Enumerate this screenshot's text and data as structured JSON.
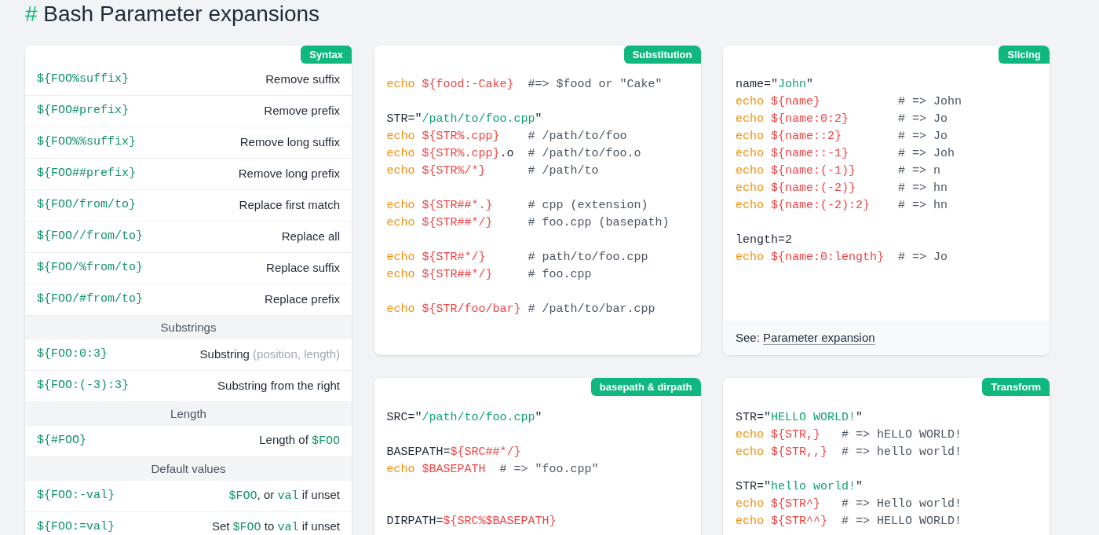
{
  "title": {
    "hash": "#",
    "text": "Bash Parameter expansions"
  },
  "syntax_card": {
    "badge": "Syntax",
    "rows": [
      {
        "kind": "row",
        "code": "${FOO%suffix}",
        "description": [
          {
            "kind": "text",
            "text": "Remove suffix"
          }
        ]
      },
      {
        "kind": "row",
        "code": "${FOO#prefix}",
        "description": [
          {
            "kind": "text",
            "text": "Remove prefix"
          }
        ]
      },
      {
        "kind": "row",
        "code": "${FOO%%suffix}",
        "description": [
          {
            "kind": "text",
            "text": "Remove long suffix"
          }
        ]
      },
      {
        "kind": "row",
        "code": "${FOO##prefix}",
        "description": [
          {
            "kind": "text",
            "text": "Remove long prefix"
          }
        ]
      },
      {
        "kind": "row",
        "code": "${FOO/from/to}",
        "description": [
          {
            "kind": "text",
            "text": "Replace first match"
          }
        ]
      },
      {
        "kind": "row",
        "code": "${FOO//from/to}",
        "description": [
          {
            "kind": "text",
            "text": "Replace all"
          }
        ]
      },
      {
        "kind": "row",
        "code": "${FOO/%from/to}",
        "description": [
          {
            "kind": "text",
            "text": "Replace suffix"
          }
        ]
      },
      {
        "kind": "row",
        "code": "${FOO/#from/to}",
        "description": [
          {
            "kind": "text",
            "text": "Replace prefix"
          }
        ]
      },
      {
        "kind": "section",
        "label": "Substrings"
      },
      {
        "kind": "row",
        "code": "${FOO:0:3}",
        "description": [
          {
            "kind": "text",
            "text": "Substring "
          },
          {
            "kind": "muted",
            "text": "(position, length)"
          }
        ]
      },
      {
        "kind": "row",
        "code": "${FOO:(-3):3}",
        "description": [
          {
            "kind": "text",
            "text": "Substring from the right"
          }
        ]
      },
      {
        "kind": "section",
        "label": "Length"
      },
      {
        "kind": "row",
        "code": "${#FOO}",
        "description": [
          {
            "kind": "text",
            "text": "Length of "
          },
          {
            "kind": "code",
            "text": "$FOO"
          }
        ]
      },
      {
        "kind": "section",
        "label": "Default values"
      },
      {
        "kind": "row",
        "code": "${FOO:-val}",
        "description": [
          {
            "kind": "code",
            "text": "$FOO"
          },
          {
            "kind": "text",
            "text": ", or "
          },
          {
            "kind": "code",
            "text": "val"
          },
          {
            "kind": "text",
            "text": " if unset"
          }
        ]
      },
      {
        "kind": "row",
        "code": "${FOO:=val}",
        "description": [
          {
            "kind": "text",
            "text": "Set "
          },
          {
            "kind": "code",
            "text": "$FOO"
          },
          {
            "kind": "text",
            "text": " to "
          },
          {
            "kind": "code",
            "text": "val"
          },
          {
            "kind": "text",
            "text": " if unset"
          }
        ]
      }
    ]
  },
  "code_cards": [
    {
      "badge": "Substitution",
      "lines": [
        {
          "kind": "code",
          "tokens": [
            {
              "kind": "keyword",
              "text": "echo "
            },
            {
              "kind": "variable",
              "text": "${food:-Cake}"
            },
            {
              "kind": "comment",
              "text": "  #=> $food or \"Cake\""
            }
          ]
        },
        {
          "kind": "blank"
        },
        {
          "kind": "code",
          "tokens": [
            {
              "kind": "plain",
              "text": "STR=\""
            },
            {
              "kind": "string",
              "text": "/path/to/foo.cpp"
            },
            {
              "kind": "plain",
              "text": "\""
            }
          ]
        },
        {
          "kind": "code",
          "tokens": [
            {
              "kind": "keyword",
              "text": "echo "
            },
            {
              "kind": "variable",
              "text": "${STR%.cpp}"
            },
            {
              "kind": "comment",
              "text": "    # /path/to/foo"
            }
          ]
        },
        {
          "kind": "code",
          "tokens": [
            {
              "kind": "keyword",
              "text": "echo "
            },
            {
              "kind": "variable",
              "text": "${STR%.cpp}"
            },
            {
              "kind": "plain",
              "text": ".o"
            },
            {
              "kind": "comment",
              "text": "  # /path/to/foo.o"
            }
          ]
        },
        {
          "kind": "code",
          "tokens": [
            {
              "kind": "keyword",
              "text": "echo "
            },
            {
              "kind": "variable",
              "text": "${STR%/*}"
            },
            {
              "kind": "comment",
              "text": "      # /path/to"
            }
          ]
        },
        {
          "kind": "blank"
        },
        {
          "kind": "code",
          "tokens": [
            {
              "kind": "keyword",
              "text": "echo "
            },
            {
              "kind": "variable",
              "text": "${STR##*.}"
            },
            {
              "kind": "comment",
              "text": "     # cpp (extension)"
            }
          ]
        },
        {
          "kind": "code",
          "tokens": [
            {
              "kind": "keyword",
              "text": "echo "
            },
            {
              "kind": "variable",
              "text": "${STR##*/}"
            },
            {
              "kind": "comment",
              "text": "     # foo.cpp (basepath)"
            }
          ]
        },
        {
          "kind": "blank"
        },
        {
          "kind": "code",
          "tokens": [
            {
              "kind": "keyword",
              "text": "echo "
            },
            {
              "kind": "variable",
              "text": "${STR#*/}"
            },
            {
              "kind": "comment",
              "text": "      # path/to/foo.cpp"
            }
          ]
        },
        {
          "kind": "code",
          "tokens": [
            {
              "kind": "keyword",
              "text": "echo "
            },
            {
              "kind": "variable",
              "text": "${STR##*/}"
            },
            {
              "kind": "comment",
              "text": "     # foo.cpp"
            }
          ]
        },
        {
          "kind": "blank"
        },
        {
          "kind": "code",
          "tokens": [
            {
              "kind": "keyword",
              "text": "echo "
            },
            {
              "kind": "variable",
              "text": "${STR/foo/bar}"
            },
            {
              "kind": "comment",
              "text": " # /path/to/bar.cpp"
            }
          ]
        }
      ]
    },
    {
      "badge": "Slicing",
      "lines": [
        {
          "kind": "code",
          "tokens": [
            {
              "kind": "plain",
              "text": "name=\""
            },
            {
              "kind": "string",
              "text": "John"
            },
            {
              "kind": "plain",
              "text": "\""
            }
          ]
        },
        {
          "kind": "code",
          "tokens": [
            {
              "kind": "keyword",
              "text": "echo "
            },
            {
              "kind": "variable",
              "text": "${name}"
            },
            {
              "kind": "comment",
              "text": "           # => John"
            }
          ]
        },
        {
          "kind": "code",
          "tokens": [
            {
              "kind": "keyword",
              "text": "echo "
            },
            {
              "kind": "variable",
              "text": "${name:0:2}"
            },
            {
              "kind": "comment",
              "text": "       # => Jo"
            }
          ]
        },
        {
          "kind": "code",
          "tokens": [
            {
              "kind": "keyword",
              "text": "echo "
            },
            {
              "kind": "variable",
              "text": "${name::2}"
            },
            {
              "kind": "comment",
              "text": "        # => Jo"
            }
          ]
        },
        {
          "kind": "code",
          "tokens": [
            {
              "kind": "keyword",
              "text": "echo "
            },
            {
              "kind": "variable",
              "text": "${name::-1}"
            },
            {
              "kind": "comment",
              "text": "       # => Joh"
            }
          ]
        },
        {
          "kind": "code",
          "tokens": [
            {
              "kind": "keyword",
              "text": "echo "
            },
            {
              "kind": "variable",
              "text": "${name:(-1)}"
            },
            {
              "kind": "comment",
              "text": "      # => n"
            }
          ]
        },
        {
          "kind": "code",
          "tokens": [
            {
              "kind": "keyword",
              "text": "echo "
            },
            {
              "kind": "variable",
              "text": "${name:(-2)}"
            },
            {
              "kind": "comment",
              "text": "      # => hn"
            }
          ]
        },
        {
          "kind": "code",
          "tokens": [
            {
              "kind": "keyword",
              "text": "echo "
            },
            {
              "kind": "variable",
              "text": "${name:(-2):2}"
            },
            {
              "kind": "comment",
              "text": "    # => hn"
            }
          ]
        },
        {
          "kind": "blank"
        },
        {
          "kind": "code",
          "tokens": [
            {
              "kind": "plain",
              "text": "length=2"
            }
          ]
        },
        {
          "kind": "code",
          "tokens": [
            {
              "kind": "keyword",
              "text": "echo "
            },
            {
              "kind": "variable",
              "text": "${name:0:length}"
            },
            {
              "kind": "comment",
              "text": "  # => Jo"
            }
          ]
        }
      ],
      "footer": {
        "prefix": "See: ",
        "link": "Parameter expansion"
      }
    },
    {
      "badge": "basepath & dirpath",
      "lines": [
        {
          "kind": "code",
          "tokens": [
            {
              "kind": "plain",
              "text": "SRC=\""
            },
            {
              "kind": "string",
              "text": "/path/to/foo.cpp"
            },
            {
              "kind": "plain",
              "text": "\""
            }
          ]
        },
        {
          "kind": "blank"
        },
        {
          "kind": "code",
          "tokens": [
            {
              "kind": "plain",
              "text": "BASEPATH="
            },
            {
              "kind": "variable",
              "text": "${SRC##*/}"
            }
          ]
        },
        {
          "kind": "code",
          "tokens": [
            {
              "kind": "keyword",
              "text": "echo "
            },
            {
              "kind": "variable",
              "text": "$BASEPATH"
            },
            {
              "kind": "comment",
              "text": "  # => \"foo.cpp\""
            }
          ]
        },
        {
          "kind": "blank"
        },
        {
          "kind": "blank"
        },
        {
          "kind": "code",
          "tokens": [
            {
              "kind": "plain",
              "text": "DIRPATH="
            },
            {
              "kind": "variable",
              "text": "${SRC%$BASEPATH}"
            }
          ]
        }
      ]
    },
    {
      "badge": "Transform",
      "lines": [
        {
          "kind": "code",
          "tokens": [
            {
              "kind": "plain",
              "text": "STR=\""
            },
            {
              "kind": "string",
              "text": "HELLO WORLD!"
            },
            {
              "kind": "plain",
              "text": "\""
            }
          ]
        },
        {
          "kind": "code",
          "tokens": [
            {
              "kind": "keyword",
              "text": "echo "
            },
            {
              "kind": "variable",
              "text": "${STR,}"
            },
            {
              "kind": "comment",
              "text": "   # => hELLO WORLD!"
            }
          ]
        },
        {
          "kind": "code",
          "tokens": [
            {
              "kind": "keyword",
              "text": "echo "
            },
            {
              "kind": "variable",
              "text": "${STR,,}"
            },
            {
              "kind": "comment",
              "text": "  # => hello world!"
            }
          ]
        },
        {
          "kind": "blank"
        },
        {
          "kind": "code",
          "tokens": [
            {
              "kind": "plain",
              "text": "STR=\""
            },
            {
              "kind": "string",
              "text": "hello world!"
            },
            {
              "kind": "plain",
              "text": "\""
            }
          ]
        },
        {
          "kind": "code",
          "tokens": [
            {
              "kind": "keyword",
              "text": "echo "
            },
            {
              "kind": "variable",
              "text": "${STR^}"
            },
            {
              "kind": "comment",
              "text": "   # => Hello world!"
            }
          ]
        },
        {
          "kind": "code",
          "tokens": [
            {
              "kind": "keyword",
              "text": "echo "
            },
            {
              "kind": "variable",
              "text": "${STR^^}"
            },
            {
              "kind": "comment",
              "text": "  # => HELLO WORLD!"
            }
          ]
        }
      ]
    }
  ]
}
